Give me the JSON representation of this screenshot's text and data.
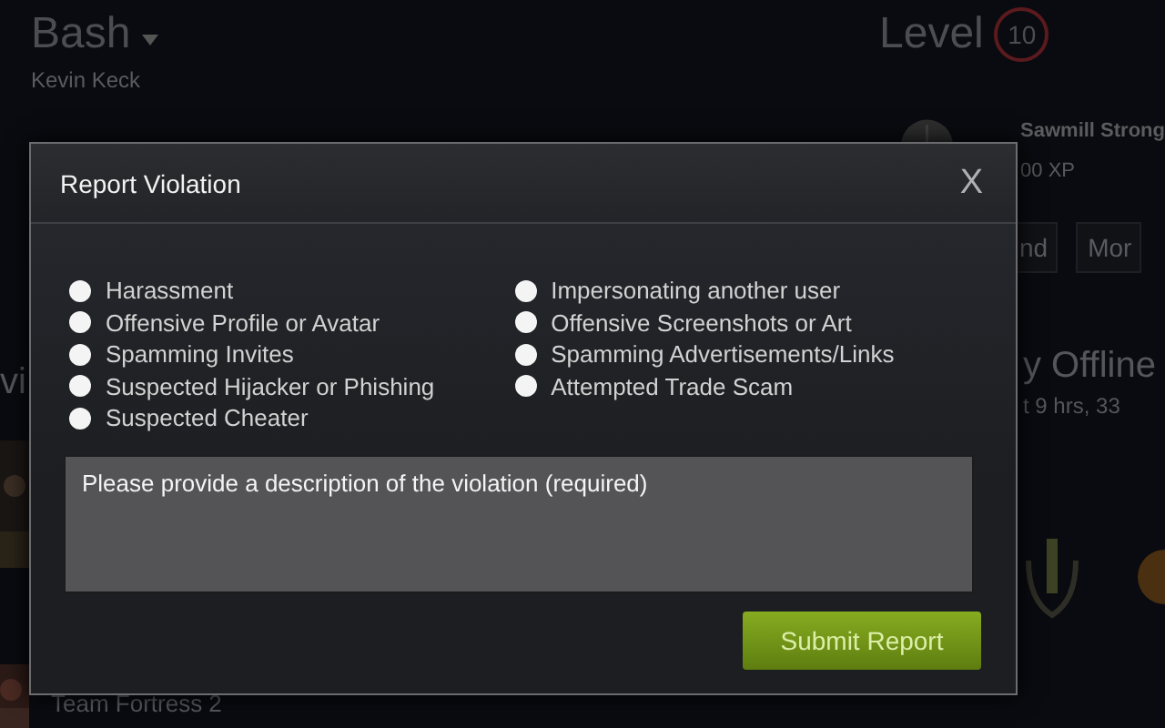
{
  "profile": {
    "name": "Bash",
    "real_name": "Kevin Keck",
    "level_label": "Level",
    "level": "10",
    "left_heading": "vi",
    "game": "Team Fortress 2"
  },
  "side": {
    "friend_name": "Sawmill Strong",
    "xp": "00 XP",
    "buttons": [
      "nd",
      "Mor"
    ],
    "status": "y Offline",
    "last_online": "t 9 hrs, 33"
  },
  "dialog": {
    "title": "Report Violation",
    "close": "X",
    "options": [
      {
        "label": "Harassment",
        "selected": false
      },
      {
        "label": "Offensive Profile or Avatar",
        "selected": false
      },
      {
        "label": "Spamming Invites",
        "selected": false
      },
      {
        "label": "Suspected Hijacker or Phishing",
        "selected": false
      },
      {
        "label": "Suspected Cheater",
        "selected": false
      },
      {
        "label": "Impersonating another user",
        "selected": false
      },
      {
        "label": "Offensive Screenshots or Art",
        "selected": false
      },
      {
        "label": "Spamming Advertisements/Links",
        "selected": false
      },
      {
        "label": "Attempted Trade Scam",
        "selected": false
      }
    ],
    "description": {
      "placeholder": "Please provide a description of the violation (required)"
    },
    "submit": "Submit Report"
  }
}
